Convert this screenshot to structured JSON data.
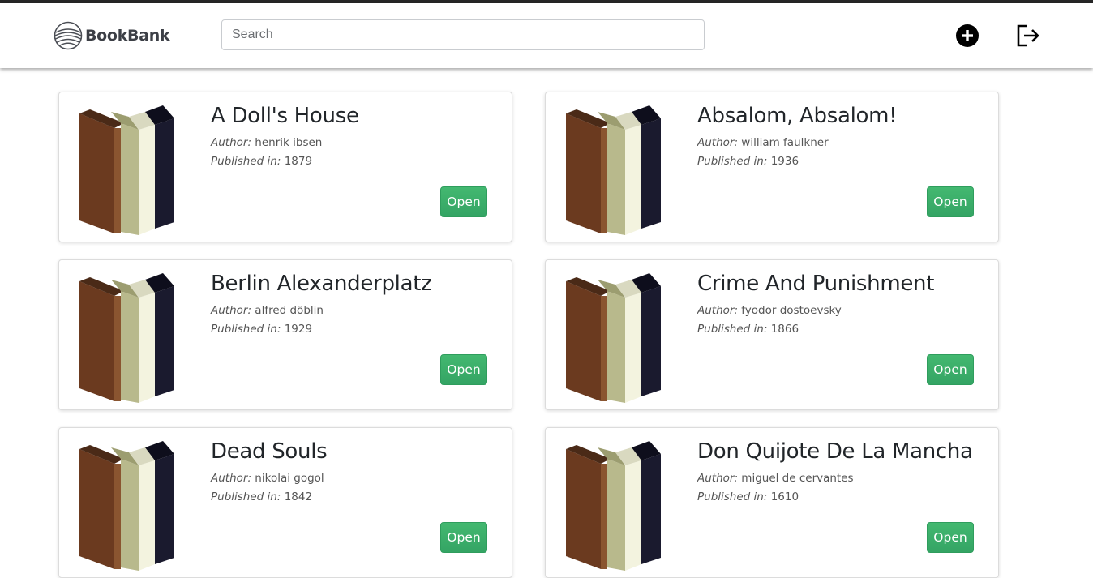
{
  "header": {
    "brand_name": "BookBank",
    "search_placeholder": "Search",
    "search_value": "",
    "add_icon": "plus-circle-icon",
    "logout_icon": "logout-icon"
  },
  "colors": {
    "open_button": "#3cb371",
    "topbar": "#262626",
    "text": "#212529"
  },
  "labels": {
    "author": "Author:",
    "published": "Published in:",
    "open": "Open"
  },
  "books": [
    {
      "title": "A Doll's House",
      "author": "henrik ibsen",
      "published": "1879"
    },
    {
      "title": "Absalom, Absalom!",
      "author": "william faulkner",
      "published": "1936"
    },
    {
      "title": "Berlin Alexanderplatz",
      "author": "alfred döblin",
      "published": "1929"
    },
    {
      "title": "Crime And Punishment",
      "author": "fyodor dostoevsky",
      "published": "1866"
    },
    {
      "title": "Dead Souls",
      "author": "nikolai gogol",
      "published": "1842"
    },
    {
      "title": "Don Quijote De La Mancha",
      "author": "miguel de cervantes",
      "published": "1610"
    }
  ]
}
